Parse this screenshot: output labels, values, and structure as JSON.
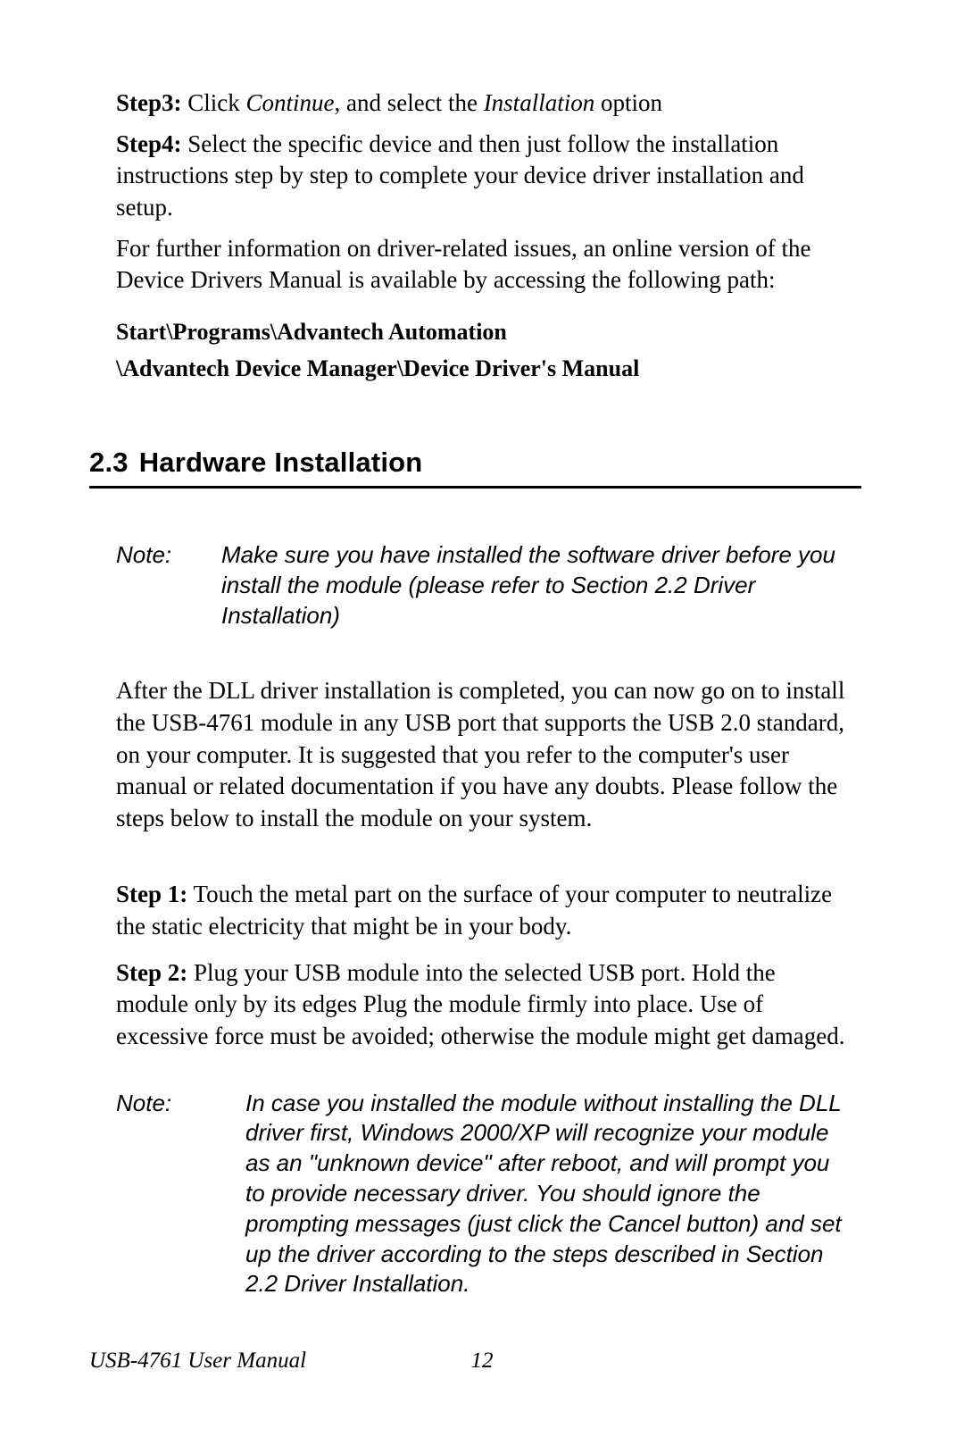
{
  "intro": {
    "step3_label": "Step3:",
    "step3_a": " Click ",
    "step3_continue": "Continue",
    "step3_b": ", and select the ",
    "step3_installation": "Installation",
    "step3_c": " option",
    "step4_label": "Step4:",
    "step4_text": " Select the specific device and then just follow the installation instructions step by step to complete your device driver installation and setup.",
    "further_info": "For further information on driver-related issues, an online version of the Device Drivers Manual is available by accessing the following path:",
    "path_line1": "Start\\Programs\\Advantech Automation",
    "path_line2": "\\Advantech Device Manager\\Device Driver's Manual"
  },
  "section": {
    "number": "2.3",
    "title": "Hardware Installation"
  },
  "note1": {
    "label": "Note:",
    "text": "Make sure you have installed the software driver before you install the module (please refer to Section 2.2 Driver Installation)"
  },
  "body": {
    "p1": "After the DLL driver installation is completed, you can now go on to install the USB-4761 module in any USB port that supports the USB 2.0 standard, on your computer. It is suggested that you refer to the computer's user manual or related documentation if you have any doubts. Please follow the steps below to install the module on your system.",
    "step1_label": "Step 1:",
    "step1_text": " Touch the metal part on the surface of your computer to neutralize the static electricity that might be in your body.",
    "step2_label": "Step 2:",
    "step2_text": " Plug your USB module into the selected USB port. Hold the module only by its edges Plug the module firmly into place. Use of excessive force must be avoided; otherwise the module might get damaged."
  },
  "note2": {
    "label": "Note:",
    "text": "In case you installed the module without installing the DLL driver first, Windows 2000/XP will recognize your module as an \"unknown device\" after reboot, and will prompt you to provide necessary driver. You should ignore the prompting messages (just click the Cancel button) and set up the driver according to the steps described in Section 2.2 Driver Installation."
  },
  "footer": {
    "title": "USB-4761 User Manual",
    "page": "12"
  }
}
